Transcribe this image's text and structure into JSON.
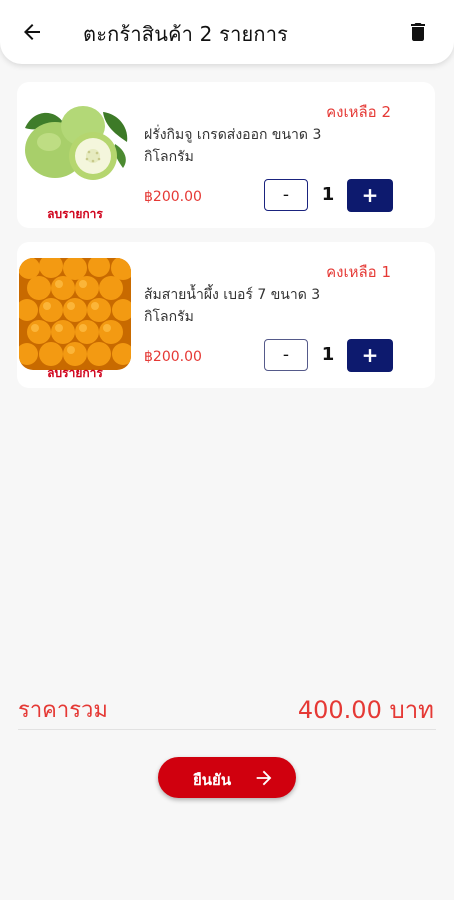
{
  "header": {
    "title": "ตะกร้าสินค้า 2 รายการ",
    "back_icon": "arrow-left-icon",
    "trash_icon": "trash-icon"
  },
  "items": [
    {
      "name": "ฝรั่งกิมจู เกรดส่งออก ขนาด 3 กิโลกรัม",
      "stock": "คงเหลือ 2",
      "price": "฿200.00",
      "minus_label": "-",
      "quantity": "1",
      "plus_label": "+",
      "remove_label": "ลบรายการ",
      "image": "guava-image"
    },
    {
      "name": "ส้มสายน้ำผึ้ง เบอร์ 7 ขนาด 3 กิโลกรัม",
      "stock": "คงเหลือ 1",
      "price": "฿200.00",
      "minus_label": "-",
      "quantity": "1",
      "plus_label": "+",
      "remove_label": "ลบรายการ",
      "image": "orange-image"
    }
  ],
  "summary": {
    "total_label": "ราคารวม",
    "total_value": "400.00 บาท"
  },
  "confirm": {
    "label": "ยืนยัน",
    "icon": "arrow-right-icon"
  },
  "colors": {
    "accent_red": "#e53935",
    "button_red": "#d0000e",
    "navy": "#0d1a6e"
  }
}
